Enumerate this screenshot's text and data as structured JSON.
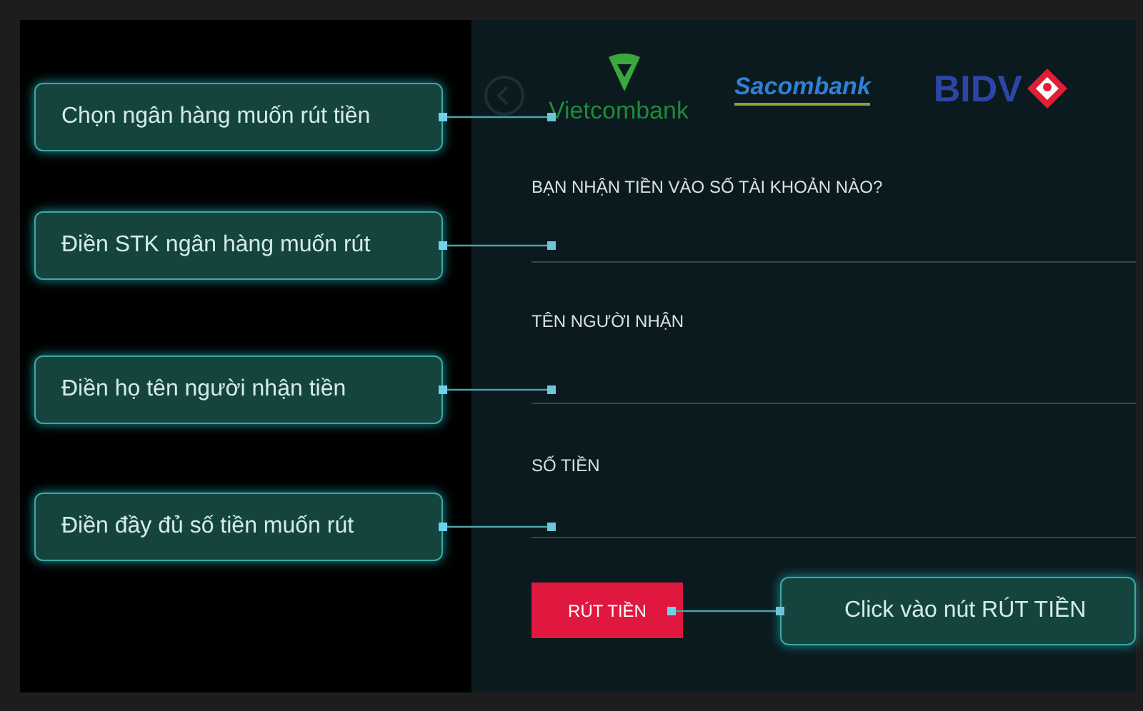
{
  "banks": [
    {
      "name": "Vietcombank",
      "kind": "triangle-mark"
    },
    {
      "name": "Sacombank",
      "kind": "underlined"
    },
    {
      "name": "BIDV",
      "kind": "diamond-mark"
    }
  ],
  "form": {
    "fields": [
      {
        "label": "BẠN NHẬN TIỀN VÀO SỐ TÀI KHOẢN NÀO?"
      },
      {
        "label": "TÊN NGƯỜI NHẬN"
      },
      {
        "label": "SỐ TIỀN"
      }
    ],
    "submit": "RÚT TIỀN"
  },
  "callouts": [
    "Chọn ngân hàng muốn rút tiền",
    "Điền STK ngân hàng muốn rút",
    "Điền họ tên người nhận tiền",
    "Điền đầy đủ số tiền muốn rút",
    "Click vào nút RÚT TIỀN"
  ]
}
